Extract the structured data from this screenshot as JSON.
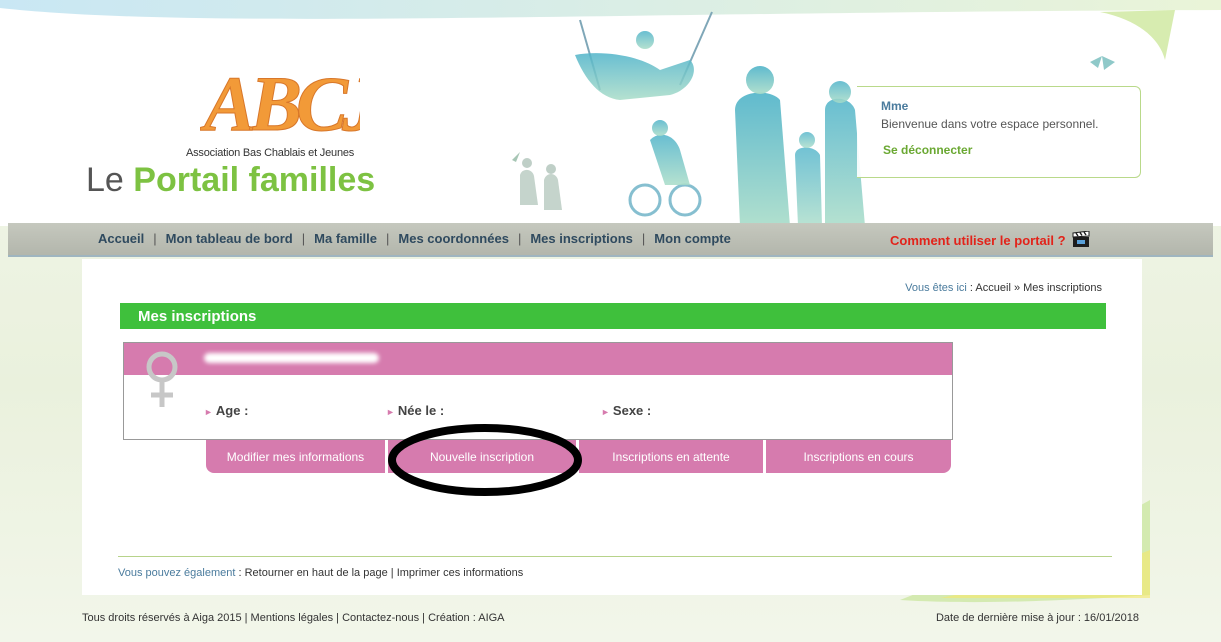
{
  "header": {
    "logo_text": "ABCJ",
    "logo_subtitle": "Association Bas Chablais et Jeunes",
    "portal_title_prefix": "Le",
    "portal_title_strong": "Portail familles"
  },
  "user_box": {
    "name": "Mme",
    "welcome": "Bienvenue dans votre espace personnel.",
    "logout": "Se déconnecter"
  },
  "nav": {
    "items": [
      "Accueil",
      "Mon tableau de bord",
      "Ma famille",
      "Mes coordonnées",
      "Mes inscriptions",
      "Mon compte"
    ],
    "separator": "|",
    "help": "Comment utiliser le portail ?"
  },
  "breadcrumb": {
    "lead": "Vous êtes ici",
    "path": " : Accueil » Mes inscriptions"
  },
  "section": {
    "title": "Mes inscriptions"
  },
  "person": {
    "age_label": "Age :",
    "born_label": "Née le :",
    "sex_label": "Sexe :"
  },
  "tabs": [
    "Modifier mes informations",
    "Nouvelle inscription",
    "Inscriptions en attente",
    "Inscriptions en cours"
  ],
  "also": {
    "lead": "Vous pouvez également",
    "colon": " : ",
    "back_top": "Retourner en haut de la page",
    "sep": " | ",
    "print": "Imprimer ces informations"
  },
  "footer": {
    "left": "Tous droits réservés à Aiga 2015 | Mentions légales | Contactez-nous | Création : AIGA",
    "right": "Date de dernière mise à jour : 16/01/2018"
  },
  "colors": {
    "accent_green": "#3fc03c",
    "pink": "#d67bae",
    "help_red": "#e2231a",
    "logo_orange": "#f29a38"
  }
}
